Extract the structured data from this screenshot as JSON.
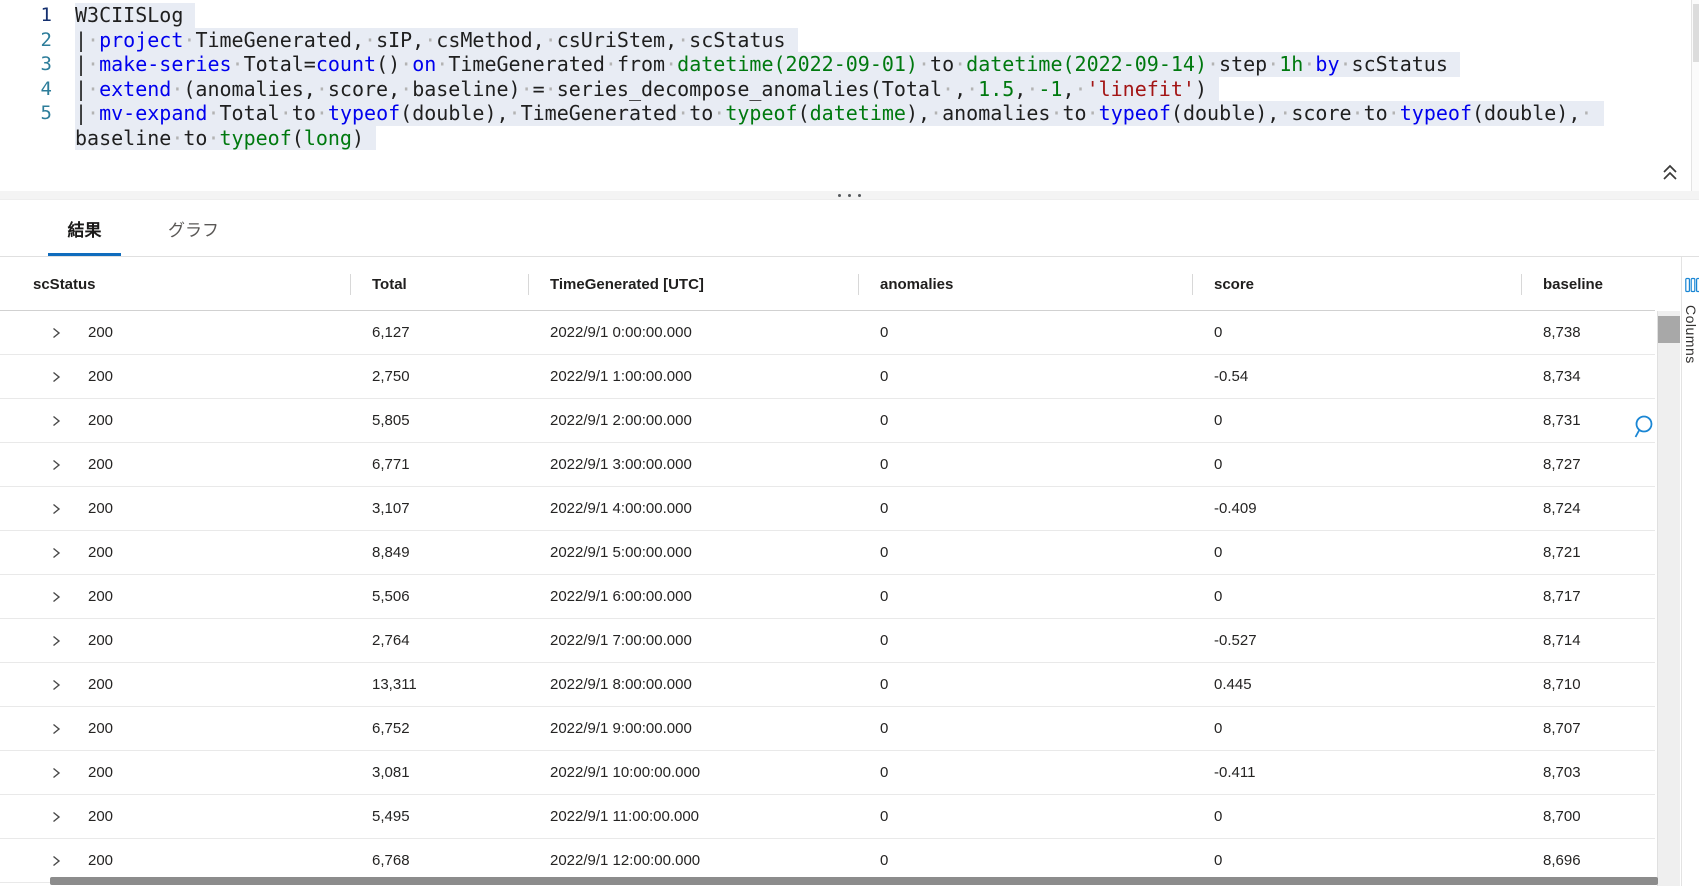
{
  "editor": {
    "rows": [
      {
        "num": "1",
        "tokens": [
          [
            "W3CIISLog",
            "p"
          ]
        ]
      },
      {
        "num": "2",
        "tokens": [
          [
            "| ",
            "p"
          ],
          [
            "project",
            "k"
          ],
          [
            " TimeGenerated, sIP, csMethod, csUriStem, scStatus",
            "p"
          ]
        ]
      },
      {
        "num": "3",
        "tokens": [
          [
            "| ",
            "p"
          ],
          [
            "make-series",
            "k"
          ],
          [
            " Total=",
            "p"
          ],
          [
            "count",
            "k"
          ],
          [
            "() ",
            "p"
          ],
          [
            "on",
            "k"
          ],
          [
            " TimeGenerated from ",
            "p"
          ],
          [
            "datetime(2022-09-01)",
            "t"
          ],
          [
            " to ",
            "p"
          ],
          [
            "datetime(2022-09-14)",
            "t"
          ],
          [
            " step ",
            "p"
          ],
          [
            "1h",
            "t"
          ],
          [
            " ",
            "p"
          ],
          [
            "by",
            "k"
          ],
          [
            " scStatus",
            "p"
          ]
        ]
      },
      {
        "num": "4",
        "tokens": [
          [
            "| ",
            "p"
          ],
          [
            "extend",
            "k"
          ],
          [
            " (anomalies, score, baseline) = series_decompose_anomalies(Total , ",
            "p"
          ],
          [
            "1.5",
            "t"
          ],
          [
            ", ",
            "p"
          ],
          [
            "-1",
            "t"
          ],
          [
            ", ",
            "p"
          ],
          [
            "'linefit'",
            "s"
          ],
          [
            ")",
            "p"
          ]
        ]
      },
      {
        "num": "5",
        "tokens": [
          [
            "| ",
            "p"
          ],
          [
            "mv-expand",
            "k"
          ],
          [
            " Total to ",
            "p"
          ],
          [
            "typeof",
            "k"
          ],
          [
            "(double), TimeGenerated to ",
            "p"
          ],
          [
            "typeof",
            "t"
          ],
          [
            "(",
            "p"
          ],
          [
            "datetime",
            "t"
          ],
          [
            "), anomalies to ",
            "p"
          ],
          [
            "typeof",
            "k"
          ],
          [
            "(double), score to ",
            "p"
          ],
          [
            "typeof",
            "k"
          ],
          [
            "(double), ",
            "p"
          ]
        ]
      },
      {
        "num": "",
        "tokens": [
          [
            "baseline to ",
            "p"
          ],
          [
            "typeof",
            "t"
          ],
          [
            "(",
            "p"
          ],
          [
            "long",
            "t"
          ],
          [
            ")",
            "p"
          ]
        ]
      }
    ]
  },
  "tabs": {
    "results_label": "結果",
    "chart_label": "グラフ"
  },
  "table": {
    "columns": [
      "scStatus",
      "Total",
      "TimeGenerated [UTC]",
      "anomalies",
      "score",
      "baseline"
    ],
    "rows": [
      [
        "200",
        "6,127",
        "2022/9/1 0:00:00.000",
        "0",
        "0",
        "8,738"
      ],
      [
        "200",
        "2,750",
        "2022/9/1 1:00:00.000",
        "0",
        "-0.54",
        "8,734"
      ],
      [
        "200",
        "5,805",
        "2022/9/1 2:00:00.000",
        "0",
        "0",
        "8,731"
      ],
      [
        "200",
        "6,771",
        "2022/9/1 3:00:00.000",
        "0",
        "0",
        "8,727"
      ],
      [
        "200",
        "3,107",
        "2022/9/1 4:00:00.000",
        "0",
        "-0.409",
        "8,724"
      ],
      [
        "200",
        "8,849",
        "2022/9/1 5:00:00.000",
        "0",
        "0",
        "8,721"
      ],
      [
        "200",
        "5,506",
        "2022/9/1 6:00:00.000",
        "0",
        "0",
        "8,717"
      ],
      [
        "200",
        "2,764",
        "2022/9/1 7:00:00.000",
        "0",
        "-0.527",
        "8,714"
      ],
      [
        "200",
        "13,311",
        "2022/9/1 8:00:00.000",
        "0",
        "0.445",
        "8,710"
      ],
      [
        "200",
        "6,752",
        "2022/9/1 9:00:00.000",
        "0",
        "0",
        "8,707"
      ],
      [
        "200",
        "3,081",
        "2022/9/1 10:00:00.000",
        "0",
        "-0.411",
        "8,703"
      ],
      [
        "200",
        "5,495",
        "2022/9/1 11:00:00.000",
        "0",
        "0",
        "8,700"
      ],
      [
        "200",
        "6,768",
        "2022/9/1 12:00:00.000",
        "0",
        "0",
        "8,696"
      ]
    ]
  },
  "side_panel": {
    "label": "Columns"
  },
  "colors": {
    "keyword": "#0000ee",
    "type_literal": "#00790f",
    "string_literal": "#a31515",
    "selection_highlight": "#e8ecf4",
    "tab_underline": "#0f6cbd",
    "search_icon": "#1a86d4",
    "columns_icon": "#1a86d4",
    "line_number": "#2d7d9a"
  }
}
